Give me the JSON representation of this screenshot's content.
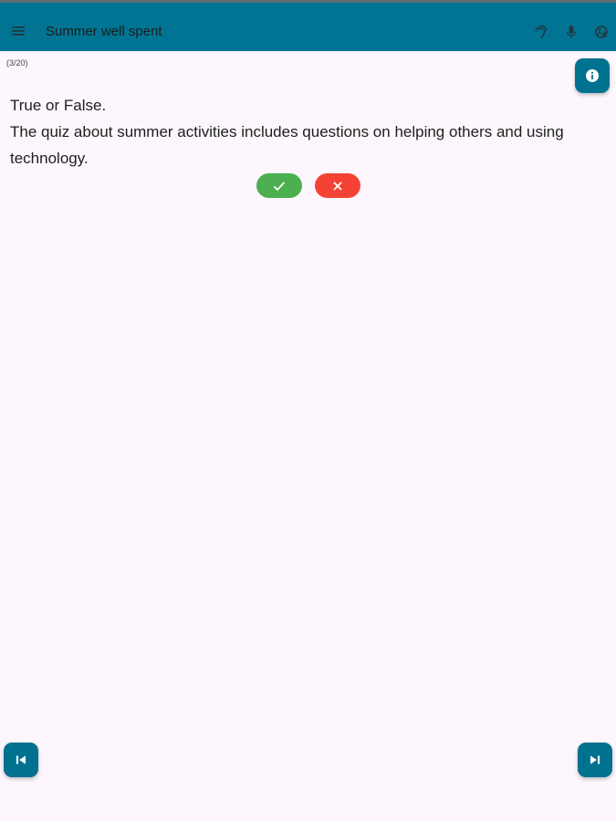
{
  "app_bar": {
    "title": "Summer well spent",
    "menu_icon": "menu-icon",
    "action_icons": [
      "hearing-icon",
      "microphone-icon",
      "translate-icon"
    ]
  },
  "quiz": {
    "counter": "(3/20)",
    "question_line1": "True or False.",
    "question_line2": "The quiz about summer activities includes questions on helping others and using technology."
  },
  "buttons": {
    "true_icon": "check-icon",
    "false_icon": "close-icon",
    "info_icon": "info-icon",
    "previous_icon": "skip-previous-icon",
    "next_icon": "skip-next-icon"
  },
  "colors": {
    "app_bar": "#007492",
    "background": "#FDF7FD",
    "true_button": "#4CAF50",
    "false_button": "#F44336",
    "fab": "#00718F"
  }
}
